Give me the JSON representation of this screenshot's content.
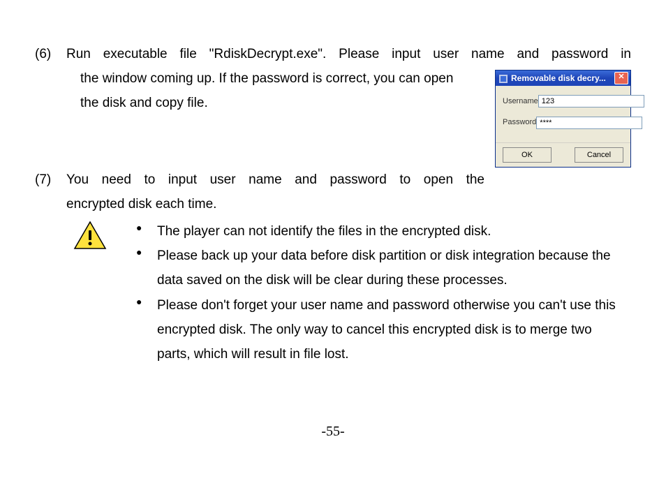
{
  "instructions": {
    "item6": {
      "num": "(6)",
      "line1_a": "Run executable file \"RdiskDecrypt.exe\". Please input user name and password in",
      "line2": "the window coming up. If the password is correct, you can open",
      "line3": "the disk and copy file."
    },
    "item7": {
      "num": "(7)",
      "line1": "You need to input user name and password to open the",
      "line2": "encrypted disk each time."
    }
  },
  "dialog": {
    "title": "Removable disk decry...",
    "username_label": "Username",
    "username_value": "123",
    "password_label": "Password",
    "password_value": "****",
    "ok": "OK",
    "cancel": "Cancel"
  },
  "bullets": {
    "b1": "The player can not identify the files in the encrypted disk.",
    "b2": "Please back up your data before disk partition or disk integration because the data saved on the disk will be clear during these processes.",
    "b3": "Please don't forget your user name and password otherwise you can't use this encrypted disk. The only way to cancel this encrypted disk is to merge two parts, which will result in file lost."
  },
  "page_number": "-55-"
}
